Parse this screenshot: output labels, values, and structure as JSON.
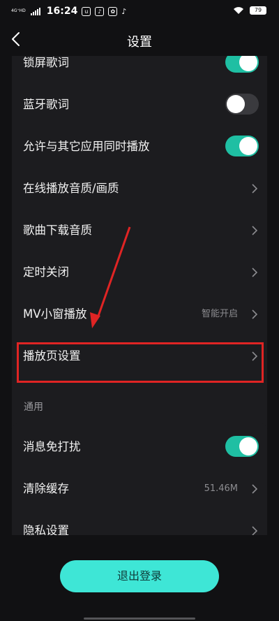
{
  "status_bar": {
    "network": "4G⁺HD",
    "time": "16:24",
    "battery": "79"
  },
  "header": {
    "title": "设置"
  },
  "settings": [
    {
      "label": "锁屏歌词",
      "type": "toggle",
      "on": true
    },
    {
      "label": "蓝牙歌词",
      "type": "toggle",
      "on": false
    },
    {
      "label": "允许与其它应用同时播放",
      "type": "toggle",
      "on": true
    },
    {
      "label": "在线播放音质/画质",
      "type": "link"
    },
    {
      "label": "歌曲下载音质",
      "type": "link"
    },
    {
      "label": "定时关闭",
      "type": "link"
    },
    {
      "label": "MV小窗播放",
      "type": "link",
      "value": "智能开启"
    },
    {
      "label": "播放页设置",
      "type": "link"
    }
  ],
  "general": {
    "section_title": "通用",
    "items": [
      {
        "label": "消息免打扰",
        "type": "toggle",
        "on": true
      },
      {
        "label": "清除缓存",
        "type": "link",
        "value": "51.46M"
      },
      {
        "label": "隐私设置",
        "type": "link"
      }
    ]
  },
  "footer": {
    "logout_label": "退出登录"
  },
  "colors": {
    "accent": "#1fbfa3",
    "logout_bg": "#3ee6d6",
    "highlight": "#e02424",
    "card_bg": "#1c1c1f",
    "page_bg": "#111113"
  }
}
